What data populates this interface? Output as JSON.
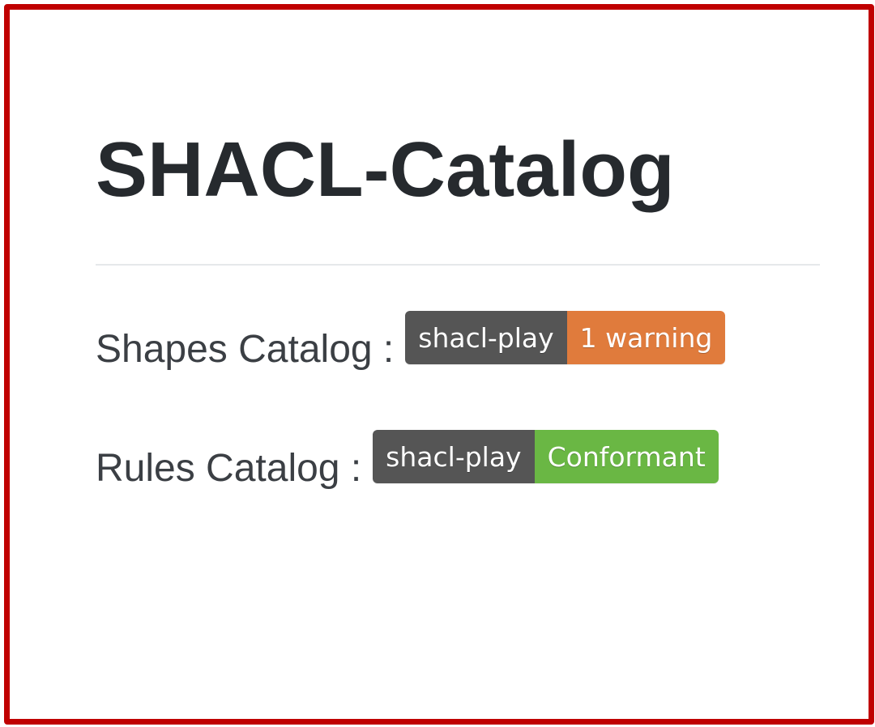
{
  "page": {
    "title": "SHACL-Catalog"
  },
  "catalogs": [
    {
      "label": "Shapes Catalog :",
      "badge": {
        "left_text": "shacl-play",
        "right_text": "1 warning",
        "right_color": "#e07b3c",
        "left_color": "#555555"
      }
    },
    {
      "label": "Rules Catalog :",
      "badge": {
        "left_text": "shacl-play",
        "right_text": "Conformant",
        "right_color": "#6ab744",
        "left_color": "#555555"
      }
    }
  ],
  "colors": {
    "frame_border": "#c00000",
    "title_text": "#262a2e",
    "body_text": "#3b3f44"
  }
}
